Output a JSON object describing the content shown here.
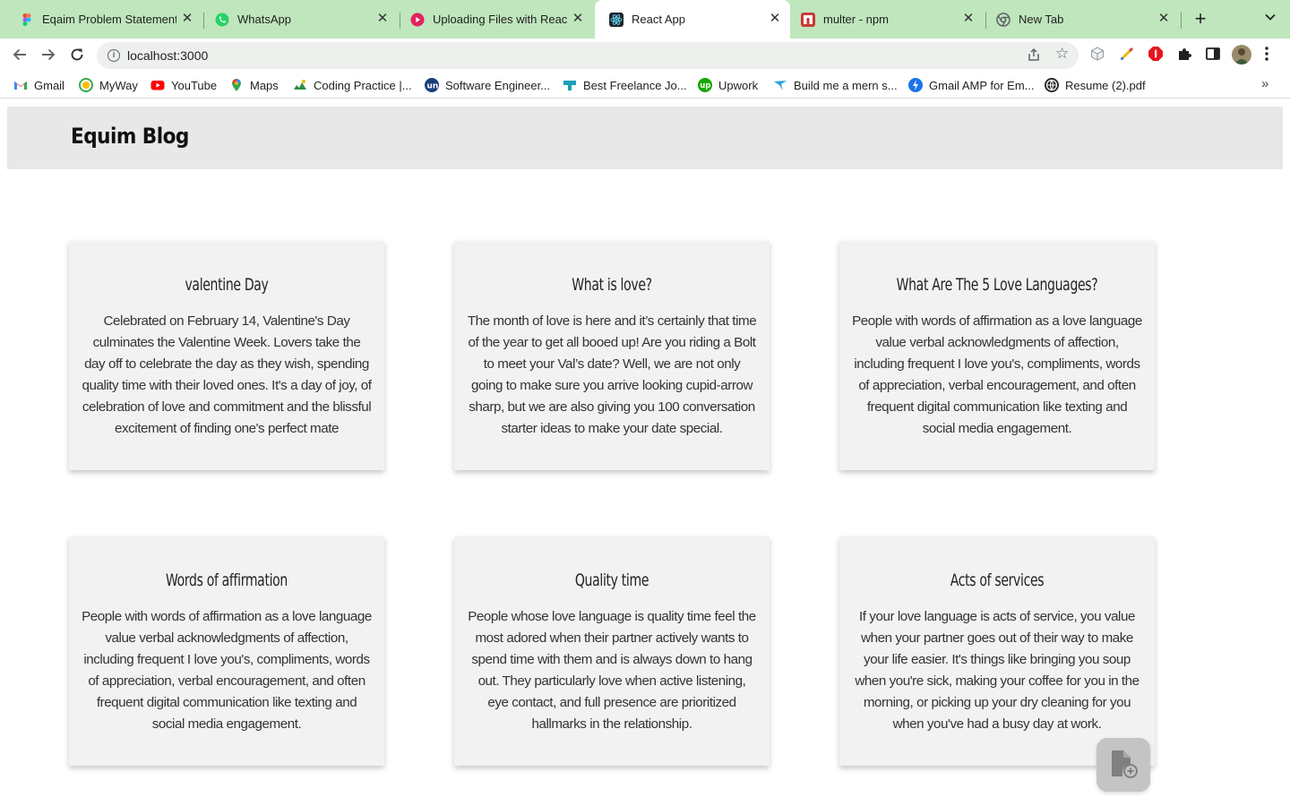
{
  "browser": {
    "tabs": [
      {
        "title": "Eqaim Problem Statement - ",
        "favicon": "figma-icon",
        "color": "#f24e1e"
      },
      {
        "title": "WhatsApp",
        "favicon": "whatsapp-icon",
        "color": "#25d366"
      },
      {
        "title": "Uploading Files with React.",
        "favicon": "play-icon",
        "color": "#e0245e"
      },
      {
        "title": "React App",
        "favicon": "react-icon",
        "color": "#20232a",
        "active": true
      },
      {
        "title": "multer - npm",
        "favicon": "npm-icon",
        "color": "#cb3837"
      },
      {
        "title": "New Tab",
        "favicon": "chrome-icon",
        "color": "#5f6368"
      }
    ],
    "address": "localhost:3000",
    "bookmarks": [
      {
        "label": "Gmail",
        "icon": "gmail-icon",
        "color": "#ea4335"
      },
      {
        "label": "MyWay",
        "icon": "myway-icon",
        "color": "#34a853"
      },
      {
        "label": "YouTube",
        "icon": "youtube-icon",
        "color": "#ff0000"
      },
      {
        "label": "Maps",
        "icon": "maps-icon",
        "color": "#34a853"
      },
      {
        "label": "Coding Practice |...",
        "icon": "coding-icon",
        "color": "#2f8d46"
      },
      {
        "label": "Software Engineer...",
        "icon": "un-icon",
        "color": "#1a3d7c"
      },
      {
        "label": "Best Freelance Jo...",
        "icon": "freelance-icon",
        "color": "#1aa0b8"
      },
      {
        "label": "Upwork",
        "icon": "upwork-icon",
        "color": "#14a800"
      },
      {
        "label": "Build me a mern s...",
        "icon": "bird-icon",
        "color": "#2aa1e6"
      },
      {
        "label": "Gmail AMP for Em...",
        "icon": "amp-icon",
        "color": "#1a73e8"
      },
      {
        "label": "Resume (2).pdf",
        "icon": "globe-icon",
        "color": "#202124"
      }
    ]
  },
  "app": {
    "brand": "Equim Blog",
    "posts": [
      {
        "title": "valentine Day",
        "body": "Celebrated on February 14, Valentine's Day culminates the Valentine Week. Lovers take the day off to celebrate the day as they wish, spending quality time with their loved ones. It's a day of joy, of celebration of love and commitment and the blissful excitement of finding one's perfect mate"
      },
      {
        "title": "What is love?",
        "body": "The month of love is here and it’s certainly that time of the year to get all booed up! Are you riding a Bolt to meet your Val’s date? Well, we are not only going to make sure you arrive looking cupid-arrow sharp, but we are also giving you 100 conversation starter ideas to make your date special."
      },
      {
        "title": "What Are The 5 Love Languages?",
        "body": "People with words of affirmation as a love language value verbal acknowledgments of affection, including frequent I love you's, compliments, words of appreciation, verbal encouragement, and often frequent digital communication like texting and social media engagement."
      },
      {
        "title": "Words of affirmation",
        "body": "People with words of affirmation as a love language value verbal acknowledgments of affection, including frequent I love you's, compliments, words of appreciation, verbal encouragement, and often frequent digital communication like texting and social media engagement."
      },
      {
        "title": "Quality time",
        "body": "People whose love language is quality time feel the most adored when their partner actively wants to spend time with them and is always down to hang out. They particularly love when active listening, eye contact, and full presence are prioritized hallmarks in the relationship."
      },
      {
        "title": "Acts of services",
        "body": "If your love language is acts of service, you value when your partner goes out of their way to make your life easier. It's things like bringing you soup when you're sick, making your coffee for you in the morning, or picking up your dry cleaning for you when you've had a busy day at work."
      }
    ],
    "fab_icon": "add-file-icon"
  }
}
